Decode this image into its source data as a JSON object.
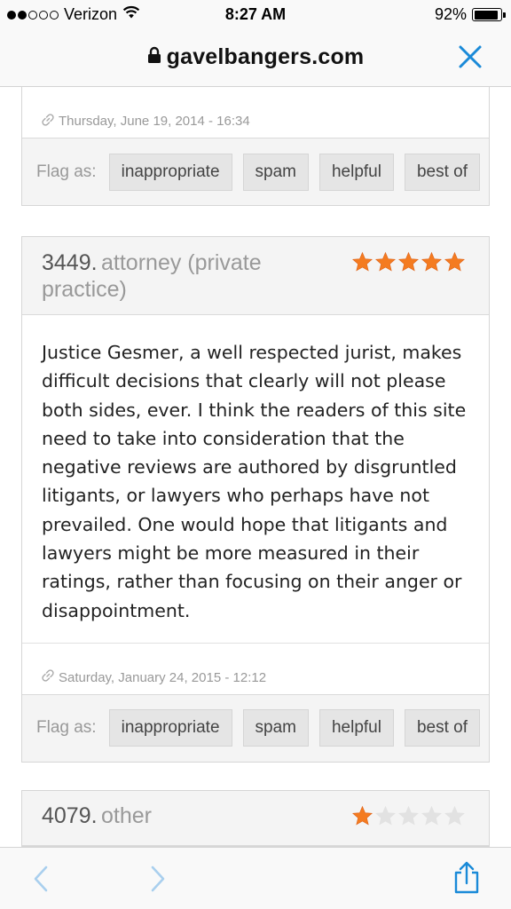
{
  "status_bar": {
    "carrier": "Verizon",
    "time": "8:27 AM",
    "battery": "92%",
    "battery_level": 0.92,
    "signal_bars_filled": 2,
    "signal_bars_total": 5
  },
  "browser": {
    "url": "gavelbangers.com"
  },
  "reviews": [
    {
      "timestamp": "Thursday, June 19, 2014 - 16:34",
      "flag": {
        "label": "Flag as:",
        "buttons": [
          "inappropriate",
          "spam",
          "helpful",
          "best of"
        ]
      }
    },
    {
      "number": "3449.",
      "author": "attorney (private practice)",
      "author_line1": "attorney (private",
      "author_line2": "practice)",
      "rating": 5,
      "body": "Justice Gesmer, a well respected jurist, makes difficult decisions that clearly will not please both sides, ever. I think the readers of this site need to take into consideration that the negative reviews are authored by disgruntled litigants, or lawyers who perhaps have not prevailed. One would hope that litigants and lawyers might be more measured in their ratings, rather than focusing on their anger or disappointment.",
      "timestamp": "Saturday, January 24, 2015 - 12:12",
      "flag": {
        "label": "Flag as:",
        "buttons": [
          "inappropriate",
          "spam",
          "helpful",
          "best of"
        ]
      }
    },
    {
      "number": "4079.",
      "author": "other",
      "rating": 1
    }
  ],
  "colors": {
    "star_filled": "#f47b20",
    "star_empty": "#e2e2e2",
    "accent": "#1a8ad8",
    "nav_disabled": "#a9cfee"
  },
  "icons": {
    "close": "close-icon",
    "lock": "lock-icon",
    "link": "link-icon",
    "back": "chevron-left-icon",
    "forward": "chevron-right-icon",
    "share": "share-icon",
    "wifi": "wifi-icon",
    "battery": "battery-icon",
    "star": "star-icon"
  }
}
